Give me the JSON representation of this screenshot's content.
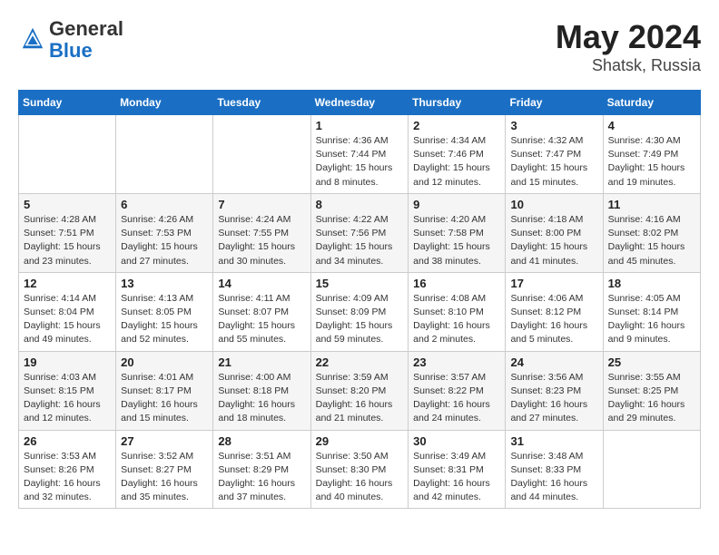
{
  "header": {
    "logo_general": "General",
    "logo_blue": "Blue",
    "title": "May 2024",
    "location": "Shatsk, Russia"
  },
  "days_of_week": [
    "Sunday",
    "Monday",
    "Tuesday",
    "Wednesday",
    "Thursday",
    "Friday",
    "Saturday"
  ],
  "weeks": [
    [
      {
        "day": "",
        "info": ""
      },
      {
        "day": "",
        "info": ""
      },
      {
        "day": "",
        "info": ""
      },
      {
        "day": "1",
        "info": "Sunrise: 4:36 AM\nSunset: 7:44 PM\nDaylight: 15 hours\nand 8 minutes."
      },
      {
        "day": "2",
        "info": "Sunrise: 4:34 AM\nSunset: 7:46 PM\nDaylight: 15 hours\nand 12 minutes."
      },
      {
        "day": "3",
        "info": "Sunrise: 4:32 AM\nSunset: 7:47 PM\nDaylight: 15 hours\nand 15 minutes."
      },
      {
        "day": "4",
        "info": "Sunrise: 4:30 AM\nSunset: 7:49 PM\nDaylight: 15 hours\nand 19 minutes."
      }
    ],
    [
      {
        "day": "5",
        "info": "Sunrise: 4:28 AM\nSunset: 7:51 PM\nDaylight: 15 hours\nand 23 minutes."
      },
      {
        "day": "6",
        "info": "Sunrise: 4:26 AM\nSunset: 7:53 PM\nDaylight: 15 hours\nand 27 minutes."
      },
      {
        "day": "7",
        "info": "Sunrise: 4:24 AM\nSunset: 7:55 PM\nDaylight: 15 hours\nand 30 minutes."
      },
      {
        "day": "8",
        "info": "Sunrise: 4:22 AM\nSunset: 7:56 PM\nDaylight: 15 hours\nand 34 minutes."
      },
      {
        "day": "9",
        "info": "Sunrise: 4:20 AM\nSunset: 7:58 PM\nDaylight: 15 hours\nand 38 minutes."
      },
      {
        "day": "10",
        "info": "Sunrise: 4:18 AM\nSunset: 8:00 PM\nDaylight: 15 hours\nand 41 minutes."
      },
      {
        "day": "11",
        "info": "Sunrise: 4:16 AM\nSunset: 8:02 PM\nDaylight: 15 hours\nand 45 minutes."
      }
    ],
    [
      {
        "day": "12",
        "info": "Sunrise: 4:14 AM\nSunset: 8:04 PM\nDaylight: 15 hours\nand 49 minutes."
      },
      {
        "day": "13",
        "info": "Sunrise: 4:13 AM\nSunset: 8:05 PM\nDaylight: 15 hours\nand 52 minutes."
      },
      {
        "day": "14",
        "info": "Sunrise: 4:11 AM\nSunset: 8:07 PM\nDaylight: 15 hours\nand 55 minutes."
      },
      {
        "day": "15",
        "info": "Sunrise: 4:09 AM\nSunset: 8:09 PM\nDaylight: 15 hours\nand 59 minutes."
      },
      {
        "day": "16",
        "info": "Sunrise: 4:08 AM\nSunset: 8:10 PM\nDaylight: 16 hours\nand 2 minutes."
      },
      {
        "day": "17",
        "info": "Sunrise: 4:06 AM\nSunset: 8:12 PM\nDaylight: 16 hours\nand 5 minutes."
      },
      {
        "day": "18",
        "info": "Sunrise: 4:05 AM\nSunset: 8:14 PM\nDaylight: 16 hours\nand 9 minutes."
      }
    ],
    [
      {
        "day": "19",
        "info": "Sunrise: 4:03 AM\nSunset: 8:15 PM\nDaylight: 16 hours\nand 12 minutes."
      },
      {
        "day": "20",
        "info": "Sunrise: 4:01 AM\nSunset: 8:17 PM\nDaylight: 16 hours\nand 15 minutes."
      },
      {
        "day": "21",
        "info": "Sunrise: 4:00 AM\nSunset: 8:18 PM\nDaylight: 16 hours\nand 18 minutes."
      },
      {
        "day": "22",
        "info": "Sunrise: 3:59 AM\nSunset: 8:20 PM\nDaylight: 16 hours\nand 21 minutes."
      },
      {
        "day": "23",
        "info": "Sunrise: 3:57 AM\nSunset: 8:22 PM\nDaylight: 16 hours\nand 24 minutes."
      },
      {
        "day": "24",
        "info": "Sunrise: 3:56 AM\nSunset: 8:23 PM\nDaylight: 16 hours\nand 27 minutes."
      },
      {
        "day": "25",
        "info": "Sunrise: 3:55 AM\nSunset: 8:25 PM\nDaylight: 16 hours\nand 29 minutes."
      }
    ],
    [
      {
        "day": "26",
        "info": "Sunrise: 3:53 AM\nSunset: 8:26 PM\nDaylight: 16 hours\nand 32 minutes."
      },
      {
        "day": "27",
        "info": "Sunrise: 3:52 AM\nSunset: 8:27 PM\nDaylight: 16 hours\nand 35 minutes."
      },
      {
        "day": "28",
        "info": "Sunrise: 3:51 AM\nSunset: 8:29 PM\nDaylight: 16 hours\nand 37 minutes."
      },
      {
        "day": "29",
        "info": "Sunrise: 3:50 AM\nSunset: 8:30 PM\nDaylight: 16 hours\nand 40 minutes."
      },
      {
        "day": "30",
        "info": "Sunrise: 3:49 AM\nSunset: 8:31 PM\nDaylight: 16 hours\nand 42 minutes."
      },
      {
        "day": "31",
        "info": "Sunrise: 3:48 AM\nSunset: 8:33 PM\nDaylight: 16 hours\nand 44 minutes."
      },
      {
        "day": "",
        "info": ""
      }
    ]
  ]
}
